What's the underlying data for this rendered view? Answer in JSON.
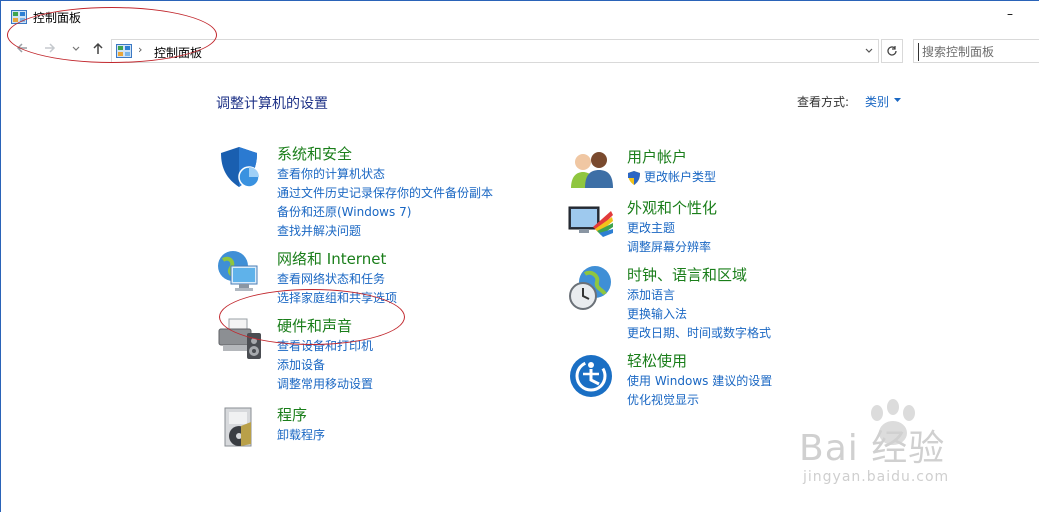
{
  "window": {
    "title": "控制面板",
    "minimize_symbol": "–"
  },
  "nav": {
    "back_icon": "arrow-left-icon",
    "forward_icon": "arrow-right-icon",
    "recent_icon": "chevron-down-icon",
    "up_icon": "arrow-up-icon",
    "address_text": "控制面板",
    "address_separator": "›",
    "refresh_icon": "refresh-icon",
    "search_placeholder": "搜索控制面板"
  },
  "main": {
    "title": "调整计算机的设置",
    "view_by_label": "查看方式:",
    "view_by_value": "类别"
  },
  "categories": [
    {
      "title": "系统和安全",
      "icon": "shield-icon",
      "links": [
        "查看你的计算机状态",
        "通过文件历史记录保存你的文件备份副本",
        "备份和还原(Windows 7)",
        "查找并解决问题"
      ]
    },
    {
      "title": "网络和 Internet",
      "icon": "network-globe-icon",
      "links": [
        "查看网络状态和任务",
        "选择家庭组和共享选项"
      ]
    },
    {
      "title": "硬件和声音",
      "icon": "printer-speaker-icon",
      "links": [
        "查看设备和打印机",
        "添加设备",
        "调整常用移动设置"
      ]
    },
    {
      "title": "程序",
      "icon": "programs-disc-icon",
      "links": [
        "卸载程序"
      ]
    },
    {
      "title": "用户帐户",
      "icon": "users-icon",
      "links": [
        "更改帐户类型"
      ]
    },
    {
      "title": "外观和个性化",
      "icon": "monitor-color-icon",
      "links": [
        "更改主题",
        "调整屏幕分辨率"
      ]
    },
    {
      "title": "时钟、语言和区域",
      "icon": "clock-globe-icon",
      "links": [
        "添加语言",
        "更换输入法",
        "更改日期、时间或数字格式"
      ]
    },
    {
      "title": "轻松使用",
      "icon": "ease-of-access-icon",
      "links": [
        "使用 Windows 建议的设置",
        "优化视觉显示"
      ]
    }
  ],
  "watermark": {
    "main": "Bai 经验",
    "sub": "jingyan.baidu.com"
  },
  "colors": {
    "link": "#1a67c3",
    "category_title": "#1a7e1a",
    "heading": "#1e3287",
    "annotation": "#c1272d"
  }
}
